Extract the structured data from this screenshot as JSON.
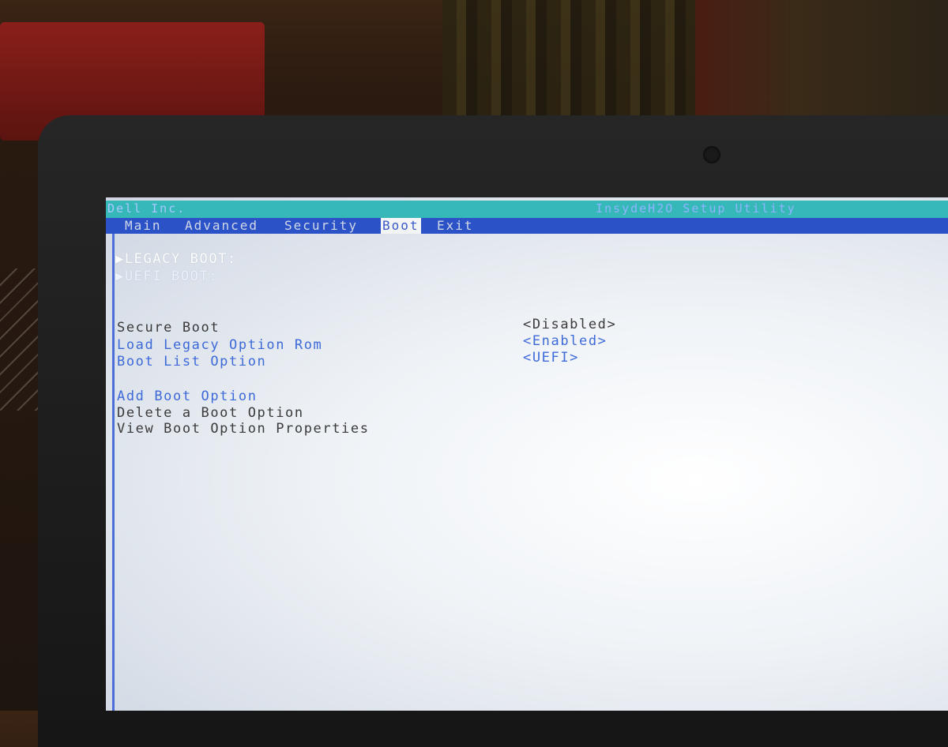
{
  "title_bar": {
    "vendor": "Dell Inc.",
    "utility": "InsydeH2O Setup Utility"
  },
  "menu": {
    "tabs": [
      "Main",
      "Advanced",
      "Security",
      "Boot",
      "Exit"
    ],
    "active": "Boot"
  },
  "boot_menu": {
    "legacy_header": "▶LEGACY BOOT:",
    "uefi_header": "▶UEFI BOOT:",
    "settings": [
      {
        "label": "Secure Boot",
        "value": "<Disabled>"
      },
      {
        "label": "Load Legacy Option Rom",
        "value": "<Enabled>"
      },
      {
        "label": "Boot List Option",
        "value": "<UEFI>"
      }
    ],
    "actions": [
      "Add Boot Option",
      "Delete a Boot Option",
      "View Boot Option Properties"
    ]
  },
  "colors": {
    "title_bar": "#36b8b8",
    "menu_bar": "#2c52c8",
    "selectable_text": "#3d6ad8",
    "static_text": "#3a3a3a"
  }
}
